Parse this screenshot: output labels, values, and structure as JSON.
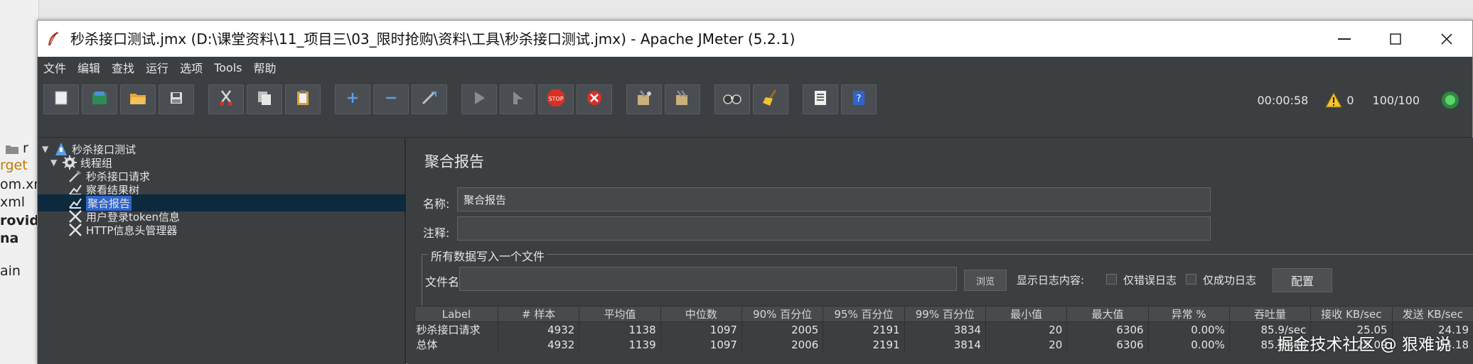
{
  "window": {
    "title": "秒杀接口测试.jmx (D:\\课堂资料\\11_项目三\\03_限时抢购\\资料\\工具\\秒杀接口测试.jmx) - Apache JMeter (5.2.1)"
  },
  "background_ide": {
    "lines": [
      "r",
      "rget",
      "om.xn",
      "xml",
      "rovide",
      "na",
      "ain"
    ]
  },
  "menu": [
    "文件",
    "编辑",
    "查找",
    "运行",
    "选项",
    "Tools",
    "帮助"
  ],
  "toolbar": {
    "elapsed": "00:00:58",
    "warnings": "0",
    "threads": "100/100"
  },
  "tree": {
    "items": [
      {
        "label": "秒杀接口测试"
      },
      {
        "label": "线程组"
      },
      {
        "label": "秒杀接口请求"
      },
      {
        "label": "察看结果树"
      },
      {
        "label": "聚合报告"
      },
      {
        "label": "用户登录token信息"
      },
      {
        "label": "HTTP信息头管理器"
      }
    ]
  },
  "report": {
    "title": "聚合报告",
    "name_label": "名称:",
    "name_value": "聚合报告",
    "comment_label": "注释:",
    "comment_value": "",
    "file_group_label": "所有数据写入一个文件",
    "filename_label": "文件名",
    "filename_value": "",
    "browse_label": "浏览",
    "log_content_label": "显示日志内容:",
    "errors_only_label": "仅错误日志",
    "success_only_label": "仅成功日志",
    "configure_label": "配置"
  },
  "table": {
    "headers": [
      "Label",
      "# 样本",
      "平均值",
      "中位数",
      "90% 百分位",
      "95% 百分位",
      "99% 百分位",
      "最小值",
      "最大值",
      "异常 %",
      "吞吐量",
      "接收 KB/sec",
      "发送 KB/sec"
    ],
    "rows": [
      [
        "秒杀接口请求",
        "4932",
        "1138",
        "1097",
        "2005",
        "2191",
        "3834",
        "20",
        "6306",
        "0.00%",
        "85.9/sec",
        "25.05",
        "24.19"
      ],
      [
        "总体",
        "4932",
        "1139",
        "1097",
        "2006",
        "2191",
        "3814",
        "20",
        "6306",
        "0.00%",
        "85.9/sec",
        "25.09",
        "24.18"
      ]
    ]
  },
  "watermark": "掘金技术社区 @ 狠难说",
  "colors": {
    "window_bg": "#3c3f41",
    "selection": "#0d293e",
    "highlight": "#2f65ca",
    "stop_red": "#d93025",
    "status_green": "#3bb54a"
  }
}
